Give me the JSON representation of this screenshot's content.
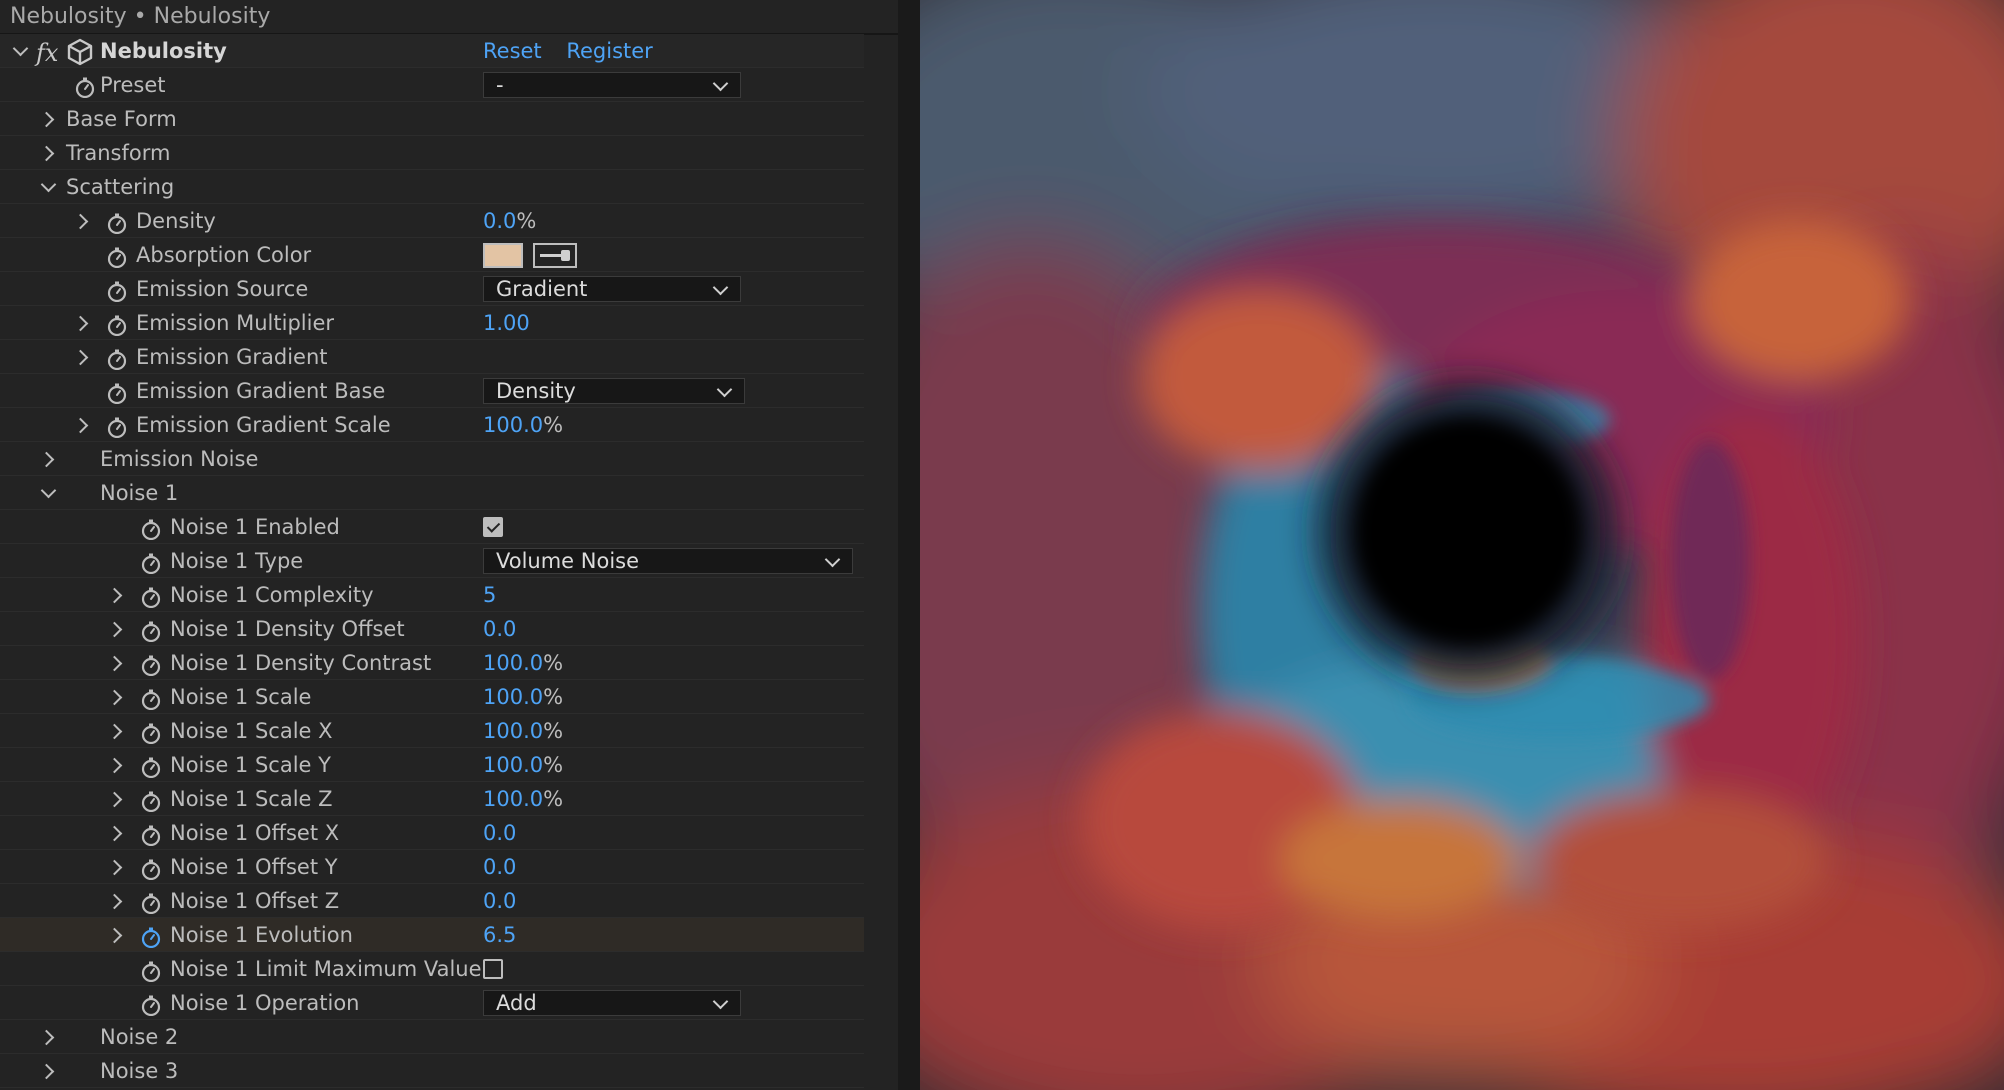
{
  "panel": {
    "title": "Nebulosity • Nebulosity"
  },
  "effect": {
    "name": "Nebulosity",
    "reset_label": "Reset",
    "register_label": "Register"
  },
  "rows": [
    {
      "id": "preset",
      "label": "Preset",
      "indent": 1,
      "twirl": "none",
      "stopwatch": true,
      "control": "dropdown",
      "value": "-",
      "width": 258
    },
    {
      "id": "base-form",
      "label": "Base Form",
      "indent": 0,
      "twirl": "right",
      "stopwatch": false,
      "control": "none"
    },
    {
      "id": "transform",
      "label": "Transform",
      "indent": 0,
      "twirl": "right",
      "stopwatch": false,
      "control": "none"
    },
    {
      "id": "scattering",
      "label": "Scattering",
      "indent": 0,
      "twirl": "down",
      "stopwatch": false,
      "control": "none"
    },
    {
      "id": "density",
      "label": "Density",
      "indent": 2,
      "twirl": "right",
      "stopwatch": true,
      "control": "number",
      "value": "0.0",
      "unit": "%"
    },
    {
      "id": "absorption-color",
      "label": "Absorption Color",
      "indent": 2,
      "twirl": "none",
      "stopwatch": true,
      "control": "color",
      "color": "#e3c4a4"
    },
    {
      "id": "emission-source",
      "label": "Emission Source",
      "indent": 2,
      "twirl": "none",
      "stopwatch": true,
      "control": "dropdown",
      "value": "Gradient",
      "width": 258
    },
    {
      "id": "emission-multiplier",
      "label": "Emission Multiplier",
      "indent": 2,
      "twirl": "right",
      "stopwatch": true,
      "control": "number",
      "value": "1.00",
      "unit": ""
    },
    {
      "id": "emission-gradient",
      "label": "Emission Gradient",
      "indent": 2,
      "twirl": "right",
      "stopwatch": true,
      "control": "none"
    },
    {
      "id": "emission-gradient-base",
      "label": "Emission Gradient Base",
      "indent": 2,
      "twirl": "none",
      "stopwatch": true,
      "control": "dropdown",
      "value": "Density",
      "width": 262
    },
    {
      "id": "emission-gradient-scale",
      "label": "Emission Gradient Scale",
      "indent": 2,
      "twirl": "right",
      "stopwatch": true,
      "control": "number",
      "value": "100.0",
      "unit": "%"
    },
    {
      "id": "emission-noise",
      "label": "Emission Noise",
      "indent": 1,
      "twirl": "right",
      "stopwatch": false,
      "control": "none"
    },
    {
      "id": "noise-1",
      "label": "Noise 1",
      "indent": 1,
      "twirl": "down",
      "stopwatch": false,
      "control": "none"
    },
    {
      "id": "noise-1-enabled",
      "label": "Noise 1 Enabled",
      "indent": 3,
      "twirl": "none",
      "stopwatch": true,
      "control": "checkbox",
      "checked": true
    },
    {
      "id": "noise-1-type",
      "label": "Noise 1 Type",
      "indent": 3,
      "twirl": "none",
      "stopwatch": true,
      "control": "dropdown",
      "value": "Volume Noise",
      "width": 370
    },
    {
      "id": "noise-1-complexity",
      "label": "Noise 1 Complexity",
      "indent": 3,
      "twirl": "right",
      "stopwatch": true,
      "control": "number",
      "value": "5",
      "unit": ""
    },
    {
      "id": "noise-1-density-offset",
      "label": "Noise 1 Density Offset",
      "indent": 3,
      "twirl": "right",
      "stopwatch": true,
      "control": "number",
      "value": "0.0",
      "unit": ""
    },
    {
      "id": "noise-1-density-contrast",
      "label": "Noise 1 Density Contrast",
      "indent": 3,
      "twirl": "right",
      "stopwatch": true,
      "control": "number",
      "value": "100.0",
      "unit": "%"
    },
    {
      "id": "noise-1-scale",
      "label": "Noise 1 Scale",
      "indent": 3,
      "twirl": "right",
      "stopwatch": true,
      "control": "number",
      "value": "100.0",
      "unit": "%"
    },
    {
      "id": "noise-1-scale-x",
      "label": "Noise 1 Scale X",
      "indent": 3,
      "twirl": "right",
      "stopwatch": true,
      "control": "number",
      "value": "100.0",
      "unit": "%"
    },
    {
      "id": "noise-1-scale-y",
      "label": "Noise 1 Scale Y",
      "indent": 3,
      "twirl": "right",
      "stopwatch": true,
      "control": "number",
      "value": "100.0",
      "unit": "%"
    },
    {
      "id": "noise-1-scale-z",
      "label": "Noise 1 Scale Z",
      "indent": 3,
      "twirl": "right",
      "stopwatch": true,
      "control": "number",
      "value": "100.0",
      "unit": "%"
    },
    {
      "id": "noise-1-offset-x",
      "label": "Noise 1 Offset X",
      "indent": 3,
      "twirl": "right",
      "stopwatch": true,
      "control": "number",
      "value": "0.0",
      "unit": ""
    },
    {
      "id": "noise-1-offset-y",
      "label": "Noise 1 Offset Y",
      "indent": 3,
      "twirl": "right",
      "stopwatch": true,
      "control": "number",
      "value": "0.0",
      "unit": ""
    },
    {
      "id": "noise-1-offset-z",
      "label": "Noise 1 Offset Z",
      "indent": 3,
      "twirl": "right",
      "stopwatch": true,
      "control": "number",
      "value": "0.0",
      "unit": ""
    },
    {
      "id": "noise-1-evolution",
      "label": "Noise 1 Evolution",
      "indent": 3,
      "twirl": "right",
      "stopwatch": true,
      "stopwatch_active": true,
      "highlight": true,
      "control": "number",
      "value": "6.5",
      "unit": ""
    },
    {
      "id": "noise-1-limit-maximum-value",
      "label": "Noise 1 Limit Maximum Value",
      "indent": 3,
      "twirl": "none",
      "stopwatch": true,
      "control": "checkbox",
      "checked": false
    },
    {
      "id": "noise-1-operation",
      "label": "Noise 1 Operation",
      "indent": 3,
      "twirl": "none",
      "stopwatch": true,
      "control": "dropdown",
      "value": "Add",
      "width": 258
    },
    {
      "id": "noise-2",
      "label": "Noise 2",
      "indent": 1,
      "twirl": "right",
      "stopwatch": false,
      "control": "none"
    },
    {
      "id": "noise-3",
      "label": "Noise 3",
      "indent": 1,
      "twirl": "right",
      "stopwatch": false,
      "control": "none"
    }
  ],
  "colors": {
    "accent": "#4ea3f5",
    "panel_bg": "#232323",
    "nebula_red": "#b3343a",
    "nebula_magenta": "#8a2a5e",
    "nebula_blue": "#2d8fb3",
    "nebula_orange": "#c7643a"
  }
}
